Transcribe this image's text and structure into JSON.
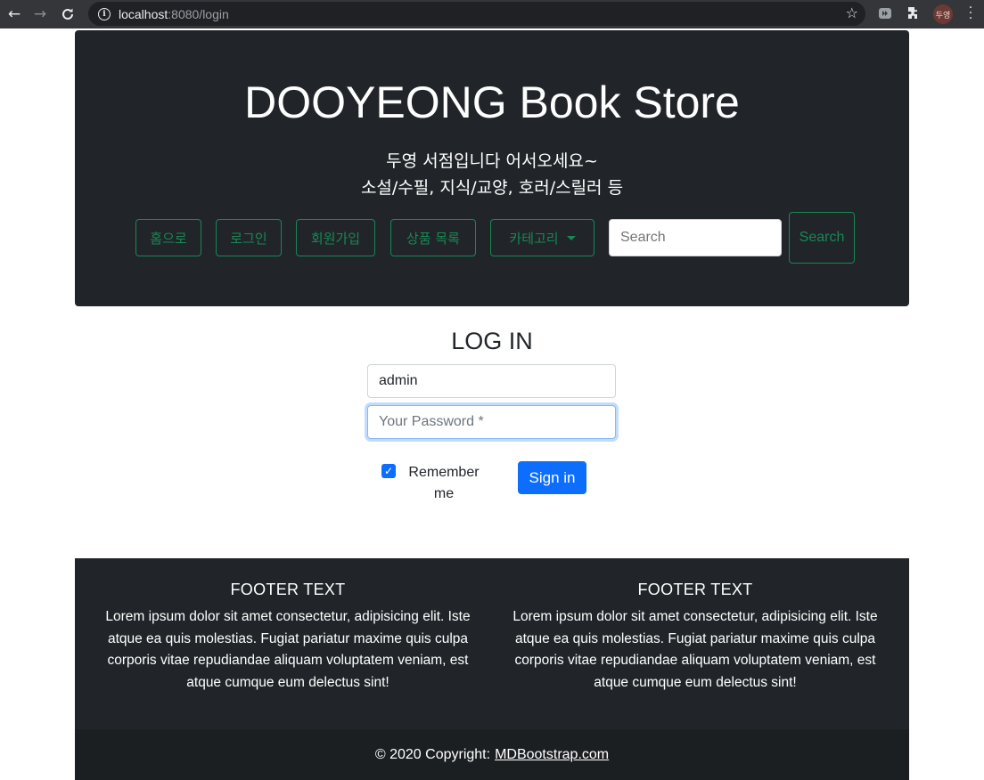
{
  "browser": {
    "url_host": "localhost",
    "url_rest": ":8080/login",
    "profile_label": "두영"
  },
  "header": {
    "title": "DOOYEONG Book Store",
    "subtitle_line1": "두영 서점입니다 어서오세요~",
    "subtitle_line2": "소설/수필, 지식/교양, 호러/스릴러 등",
    "nav": {
      "home": "홈으로",
      "login": "로그인",
      "signup": "회원가입",
      "products": "상품 목록",
      "category": "카테고리"
    },
    "search_placeholder": "Search",
    "search_button": "Search"
  },
  "login": {
    "title": "LOG IN",
    "username_value": "admin",
    "password_placeholder": "Your Password *",
    "remember_label": "Remember me",
    "remember_checked": true,
    "signin_label": "Sign in"
  },
  "footer": {
    "columns": [
      {
        "heading": "FOOTER TEXT",
        "text": "Lorem ipsum dolor sit amet consectetur, adipisicing elit. Iste atque ea quis molestias. Fugiat pariatur maxime quis culpa corporis vitae repudiandae aliquam voluptatem veniam, est atque cumque eum delectus sint!"
      },
      {
        "heading": "FOOTER TEXT",
        "text": "Lorem ipsum dolor sit amet consectetur, adipisicing elit. Iste atque ea quis molestias. Fugiat pariatur maxime quis culpa corporis vitae repudiandae aliquam voluptatem veniam, est atque cumque eum delectus sint!"
      }
    ],
    "copyright_text": "© 2020 Copyright:",
    "copyright_link": "MDBootstrap.com"
  },
  "colors": {
    "header_bg": "#212529",
    "outline_green": "#198754",
    "primary_blue": "#0d6efd"
  }
}
